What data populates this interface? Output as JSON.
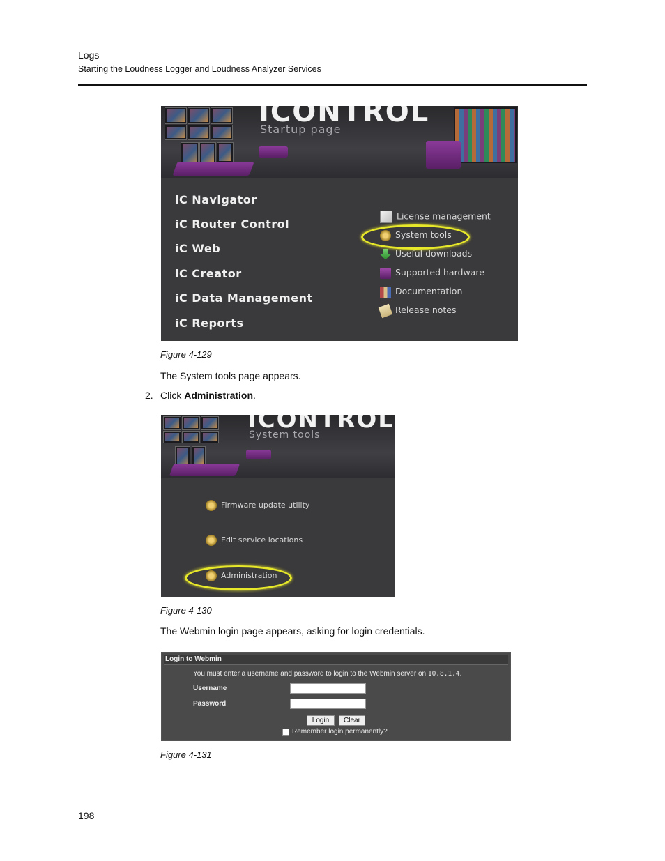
{
  "header": {
    "title": "Logs",
    "subtitle": "Starting the Loudness Logger and Loudness Analyzer Services"
  },
  "figure1": {
    "logo": "ICONTROL",
    "subtitle": "Startup page",
    "nav_items": [
      "iC Navigator",
      "iC Router Control",
      "iC Web",
      "iC Creator",
      "iC Data Management",
      "iC Reports"
    ],
    "links": [
      {
        "label": "License management",
        "icon": "certificate-icon"
      },
      {
        "label": "System tools",
        "icon": "wrench-gear-icon"
      },
      {
        "label": "Useful downloads",
        "icon": "download-arrow-icon"
      },
      {
        "label": "Supported hardware",
        "icon": "hardware-box-icon"
      },
      {
        "label": "Documentation",
        "icon": "books-icon"
      },
      {
        "label": "Release notes",
        "icon": "notepad-icon"
      }
    ],
    "highlight_color": "#e8e82a",
    "caption": "Figure 4-129"
  },
  "text1": "The System tools page appears.",
  "step2": {
    "number": "2.",
    "prefix": "Click ",
    "bold": "Administration",
    "suffix": "."
  },
  "figure2": {
    "logo": "ICONTROL",
    "subtitle": "System tools",
    "items": [
      {
        "label": "Firmware update utility",
        "icon": "wrench-gear-icon"
      },
      {
        "label": "Edit service locations",
        "icon": "wrench-gear-icon"
      },
      {
        "label": "Administration",
        "icon": "wrench-gear-icon"
      }
    ],
    "caption": "Figure 4-130"
  },
  "text2": "The Webmin login page appears, asking for login credentials.",
  "figure3": {
    "header": "Login to Webmin",
    "message_prefix": "You must enter a username and password to login to the Webmin server on ",
    "server_ip": "10.8.1.4",
    "message_suffix": ".",
    "username_label": "Username",
    "password_label": "Password",
    "login_button": "Login",
    "clear_button": "Clear",
    "remember_label": "Remember login permanently?",
    "caption": "Figure 4-131"
  },
  "page_number": "198"
}
